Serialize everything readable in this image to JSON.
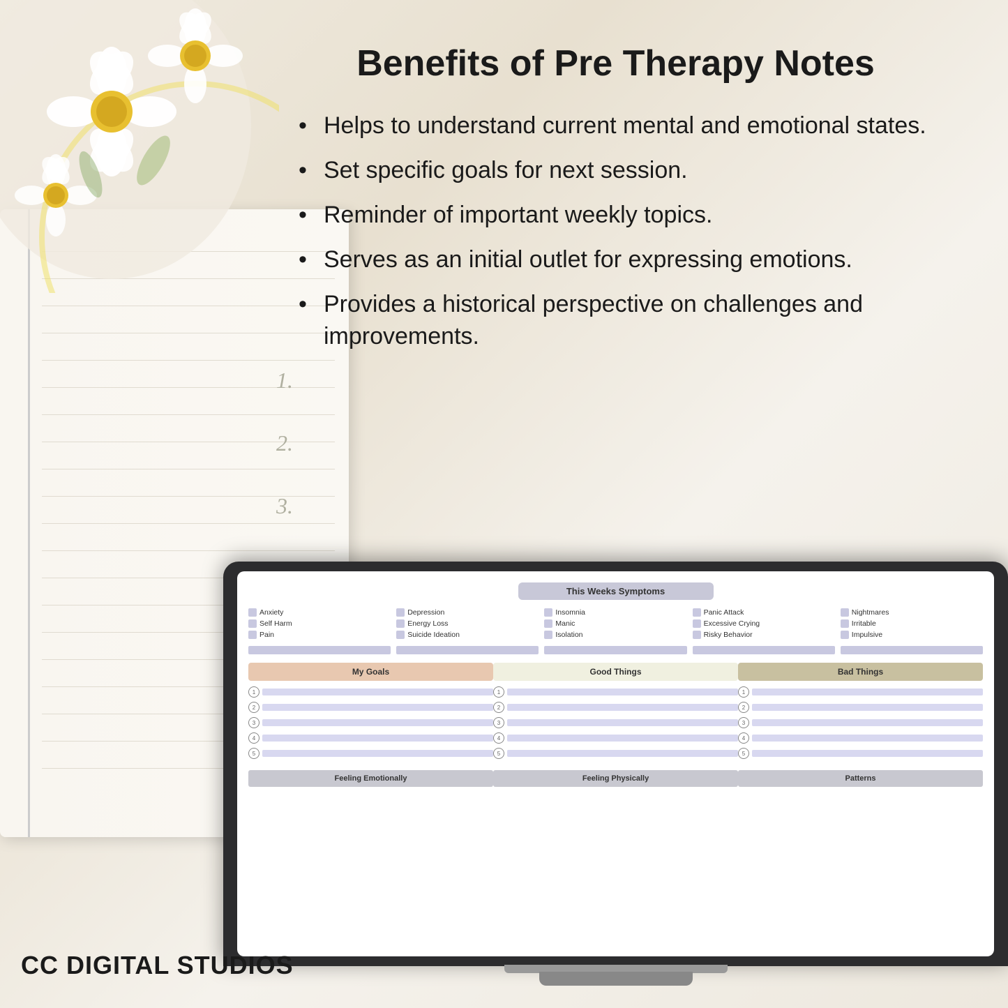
{
  "page": {
    "title": "Benefits of Pre Therapy Notes",
    "background_color": "#f5f0e8"
  },
  "benefits": {
    "items": [
      "Helps to understand current mental and emotional states.",
      "Set specific goals for next session.",
      "Reminder of important weekly topics.",
      "Serves as an initial outlet for expressing emotions.",
      "Provides a historical perspective on challenges and improvements."
    ]
  },
  "laptop": {
    "screen": {
      "symptoms_header": "This Weeks Symptoms",
      "symptoms": [
        "Anxiety",
        "Depression",
        "Insomnia",
        "Panic Attack",
        "Nightmares",
        "Self Harm",
        "Energy Loss",
        "Manic",
        "Excessive Crying",
        "Irritable",
        "Pain",
        "Suicide Ideation",
        "Isolation",
        "Risky Behavior",
        "Impulsive"
      ],
      "goals_header": "My Goals",
      "good_header": "Good Things",
      "bad_header": "Bad Things",
      "list_numbers": [
        "1",
        "2",
        "3",
        "4",
        "5"
      ],
      "bottom_labels": [
        "Feeling Emotionally",
        "Feeling Physically",
        "Patterns"
      ]
    }
  },
  "brand": {
    "text": "CC DIGITAL STUDIOS"
  }
}
